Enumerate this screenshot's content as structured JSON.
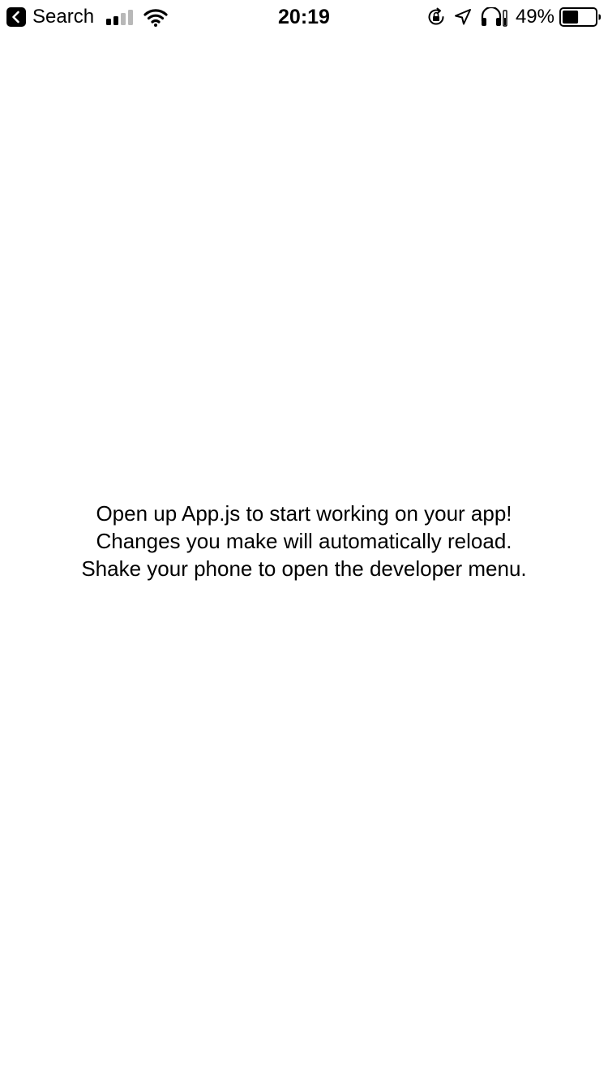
{
  "status_bar": {
    "back_label": "Search",
    "time": "20:19",
    "battery_percent": "49%",
    "battery_level": 0.49,
    "signal_bars_filled": 2,
    "signal_bars_total": 4,
    "icons": [
      "back-arrow-icon",
      "signal-icon",
      "wifi-icon",
      "orientation-lock-icon",
      "location-arrow-icon",
      "headphones-icon",
      "battery-icon"
    ]
  },
  "main": {
    "lines": [
      "Open up App.js to start working on your app!",
      "Changes you make will automatically reload.",
      "Shake your phone to open the developer menu."
    ]
  },
  "colors": {
    "background": "#ffffff",
    "text": "#000000",
    "inactive_signal": "#b8b8b8"
  }
}
